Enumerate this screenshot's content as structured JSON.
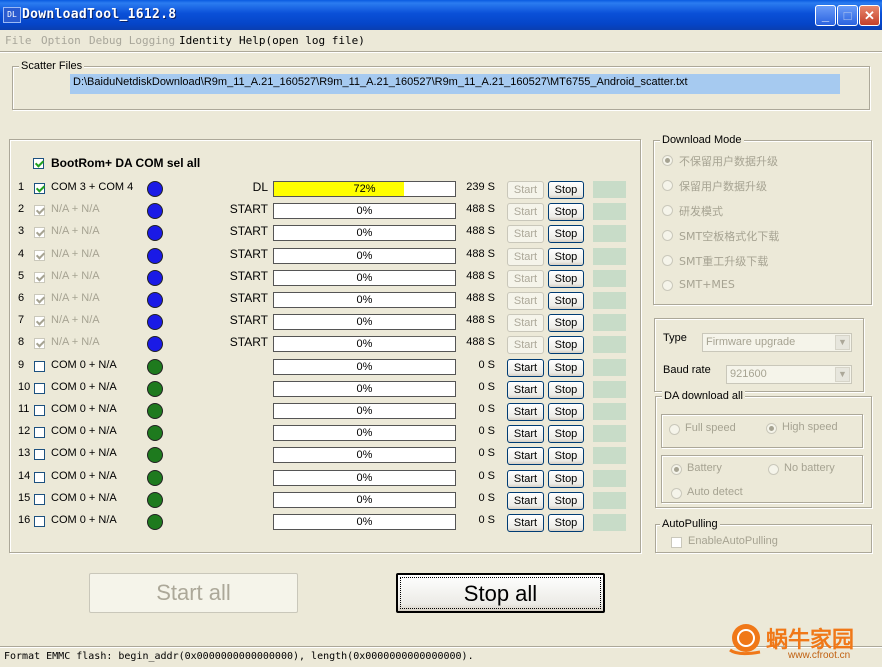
{
  "window": {
    "title": "DownloadTool_1612.8",
    "icon": "app-icon"
  },
  "menu": [
    {
      "label": "File",
      "enabled": false
    },
    {
      "label": "Option",
      "enabled": false
    },
    {
      "label": "Debug Logging",
      "enabled": false
    },
    {
      "label": "Identity",
      "enabled": true
    },
    {
      "label": "Help(open log file)",
      "enabled": true
    }
  ],
  "scatter": {
    "legend": "Scatter Files",
    "path": "D:\\BaiduNetdiskDownload\\R9m_11_A.21_160527\\R9m_11_A.21_160527\\R9m_11_A.21_160527\\MT6755_Android_scatter.txt"
  },
  "ports": {
    "select_all_label": "BootRom+ DA COM sel all",
    "select_all_checked": true,
    "rows": [
      {
        "num": "1",
        "checked": true,
        "enabled": true,
        "label": "COM 3 + COM 4",
        "dot": "#1a1ae6",
        "state": "DL",
        "progress": 72,
        "pct": "72%",
        "time": "239 S",
        "start": "Start",
        "start_enabled": false,
        "stop": "Stop"
      },
      {
        "num": "2",
        "checked": true,
        "enabled": false,
        "label": "N/A + N/A",
        "dot": "#1a1ae6",
        "state": "START",
        "progress": 0,
        "pct": "0%",
        "time": "488 S",
        "start": "Start",
        "start_enabled": false,
        "stop": "Stop"
      },
      {
        "num": "3",
        "checked": true,
        "enabled": false,
        "label": "N/A + N/A",
        "dot": "#1a1ae6",
        "state": "START",
        "progress": 0,
        "pct": "0%",
        "time": "488 S",
        "start": "Start",
        "start_enabled": false,
        "stop": "Stop"
      },
      {
        "num": "4",
        "checked": true,
        "enabled": false,
        "label": "N/A + N/A",
        "dot": "#1a1ae6",
        "state": "START",
        "progress": 0,
        "pct": "0%",
        "time": "488 S",
        "start": "Start",
        "start_enabled": false,
        "stop": "Stop"
      },
      {
        "num": "5",
        "checked": true,
        "enabled": false,
        "label": "N/A + N/A",
        "dot": "#1a1ae6",
        "state": "START",
        "progress": 0,
        "pct": "0%",
        "time": "488 S",
        "start": "Start",
        "start_enabled": false,
        "stop": "Stop"
      },
      {
        "num": "6",
        "checked": true,
        "enabled": false,
        "label": "N/A + N/A",
        "dot": "#1a1ae6",
        "state": "START",
        "progress": 0,
        "pct": "0%",
        "time": "488 S",
        "start": "Start",
        "start_enabled": false,
        "stop": "Stop"
      },
      {
        "num": "7",
        "checked": true,
        "enabled": false,
        "label": "N/A + N/A",
        "dot": "#1a1ae6",
        "state": "START",
        "progress": 0,
        "pct": "0%",
        "time": "488 S",
        "start": "Start",
        "start_enabled": false,
        "stop": "Stop"
      },
      {
        "num": "8",
        "checked": true,
        "enabled": false,
        "label": "N/A + N/A",
        "dot": "#1a1ae6",
        "state": "START",
        "progress": 0,
        "pct": "0%",
        "time": "488 S",
        "start": "Start",
        "start_enabled": false,
        "stop": "Stop"
      },
      {
        "num": "9",
        "checked": false,
        "enabled": true,
        "label": "COM 0 + N/A",
        "dot": "#1e7a1e",
        "state": "",
        "progress": 0,
        "pct": "0%",
        "time": "0 S",
        "start": "Start",
        "start_enabled": true,
        "stop": "Stop"
      },
      {
        "num": "10",
        "checked": false,
        "enabled": true,
        "label": "COM 0 + N/A",
        "dot": "#1e7a1e",
        "state": "",
        "progress": 0,
        "pct": "0%",
        "time": "0 S",
        "start": "Start",
        "start_enabled": true,
        "stop": "Stop"
      },
      {
        "num": "11",
        "checked": false,
        "enabled": true,
        "label": "COM 0 + N/A",
        "dot": "#1e7a1e",
        "state": "",
        "progress": 0,
        "pct": "0%",
        "time": "0 S",
        "start": "Start",
        "start_enabled": true,
        "stop": "Stop"
      },
      {
        "num": "12",
        "checked": false,
        "enabled": true,
        "label": "COM 0 + N/A",
        "dot": "#1e7a1e",
        "state": "",
        "progress": 0,
        "pct": "0%",
        "time": "0 S",
        "start": "Start",
        "start_enabled": true,
        "stop": "Stop"
      },
      {
        "num": "13",
        "checked": false,
        "enabled": true,
        "label": "COM 0 + N/A",
        "dot": "#1e7a1e",
        "state": "",
        "progress": 0,
        "pct": "0%",
        "time": "0 S",
        "start": "Start",
        "start_enabled": true,
        "stop": "Stop"
      },
      {
        "num": "14",
        "checked": false,
        "enabled": true,
        "label": "COM 0 + N/A",
        "dot": "#1e7a1e",
        "state": "",
        "progress": 0,
        "pct": "0%",
        "time": "0 S",
        "start": "Start",
        "start_enabled": true,
        "stop": "Stop"
      },
      {
        "num": "15",
        "checked": false,
        "enabled": true,
        "label": "COM 0 + N/A",
        "dot": "#1e7a1e",
        "state": "",
        "progress": 0,
        "pct": "0%",
        "time": "0 S",
        "start": "Start",
        "start_enabled": true,
        "stop": "Stop"
      },
      {
        "num": "16",
        "checked": false,
        "enabled": true,
        "label": "COM 0 + N/A",
        "dot": "#1e7a1e",
        "state": "",
        "progress": 0,
        "pct": "0%",
        "time": "0 S",
        "start": "Start",
        "start_enabled": true,
        "stop": "Stop"
      }
    ]
  },
  "download_mode": {
    "legend": "Download Mode",
    "options": [
      {
        "label": "不保留用户数据升级",
        "selected": true
      },
      {
        "label": "保留用户数据升级",
        "selected": false
      },
      {
        "label": "研发模式",
        "selected": false
      },
      {
        "label": "SMT空板格式化下载",
        "selected": false
      },
      {
        "label": "SMT重工升级下载",
        "selected": false
      },
      {
        "label": "SMT+MES",
        "selected": false
      }
    ]
  },
  "settings": {
    "type_label": "Type",
    "type_value": "Firmware upgrade",
    "baud_label": "Baud rate",
    "baud_value": "921600"
  },
  "da_download": {
    "legend": "DA download all",
    "speed_options": [
      {
        "label": "Full speed",
        "selected": false
      },
      {
        "label": "High speed",
        "selected": true
      }
    ],
    "battery_options": [
      {
        "label": "Battery",
        "selected": true
      },
      {
        "label": "No battery",
        "selected": false
      },
      {
        "label": "Auto detect",
        "selected": false
      }
    ]
  },
  "autopulling": {
    "legend": "AutoPulling",
    "checkbox_label": "EnableAutoPulling",
    "checked": false
  },
  "actions": {
    "start_all": "Start all",
    "stop_all": "Stop all"
  },
  "status_text": "Format EMMC flash:  begin_addr(0x0000000000000000), length(0x0000000000000000).",
  "watermark": {
    "text": "蜗牛家园",
    "url": "www.cfroot.cn"
  },
  "colors": {
    "progress_fill": "#ffff00",
    "titlebar": "#0a50d8",
    "active_dot": "#1a1ae6",
    "idle_dot": "#1e7a1e"
  }
}
